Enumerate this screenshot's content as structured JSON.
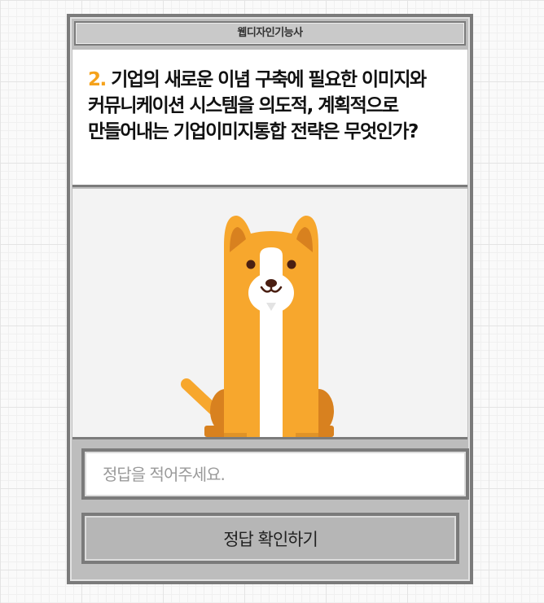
{
  "app": {
    "title": "웹디자인기능사"
  },
  "question": {
    "number": "2.",
    "text": "기업의 새로운 이념 구축에 필요한 이미지와 커뮤니케이션 시스템을 의도적, 계획적으로 만들어내는 기업이미지통합 전략은 무엇인가?"
  },
  "illustration": {
    "icon": "dog-illustration"
  },
  "answer": {
    "placeholder": "정답을 적어주세요.",
    "value": ""
  },
  "submit": {
    "label": "정답 확인하기"
  },
  "colors": {
    "accent": "#f5a21b",
    "dog_body": "#f7a72d",
    "dog_shade": "#d8811f",
    "dog_belly": "#ffffff",
    "frame_border": "#7b7b7b",
    "frame_fill": "#bdbdbd",
    "button_fill": "#b6b6b6"
  }
}
